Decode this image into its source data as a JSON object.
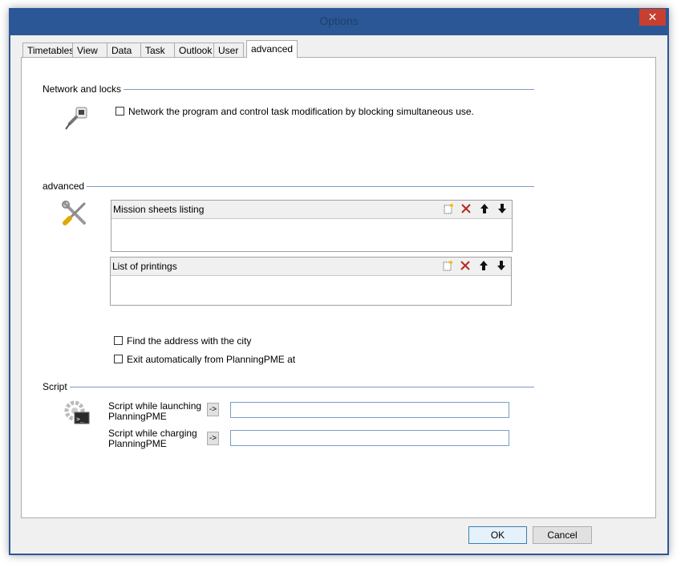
{
  "window": {
    "title": "Options",
    "close_glyph": "✕"
  },
  "tabs": [
    {
      "label": "Timetables"
    },
    {
      "label": "View"
    },
    {
      "label": "Data"
    },
    {
      "label": "Task"
    },
    {
      "label": "Outlook"
    },
    {
      "label": "User"
    },
    {
      "label": "advanced",
      "active": true
    }
  ],
  "network": {
    "title": "Network and locks",
    "icon": "network-plug-icon",
    "checkbox_label": "Network the program and control task modification by blocking simultaneous use.",
    "checked": false
  },
  "advanced": {
    "title": "advanced",
    "icon": "tools-icon",
    "mission_sheets": {
      "title": "Mission sheets listing"
    },
    "printings": {
      "title": "List of printings"
    },
    "list_buttons": {
      "new": "new-icon",
      "delete": "delete-icon",
      "up": "arrow-up-icon",
      "down": "arrow-down-icon"
    },
    "find_address_label": "Find the address with the city",
    "find_address_checked": false,
    "exit_auto_label": "Exit automatically from PlanningPME at",
    "exit_auto_checked": false
  },
  "script": {
    "title": "Script",
    "icon": "script-gear-icon",
    "launching_label_1": "Script while launching",
    "launching_label_2": "PlanningPME",
    "launching_value": "",
    "charging_label_1": "Script while charging",
    "charging_label_2": "PlanningPME",
    "charging_value": "",
    "browse_label": "->"
  },
  "buttons": {
    "ok": "OK",
    "cancel": "Cancel"
  },
  "colors": {
    "accent": "#2b5797",
    "close": "#c7402f",
    "group_line": "#7a9cc7"
  }
}
